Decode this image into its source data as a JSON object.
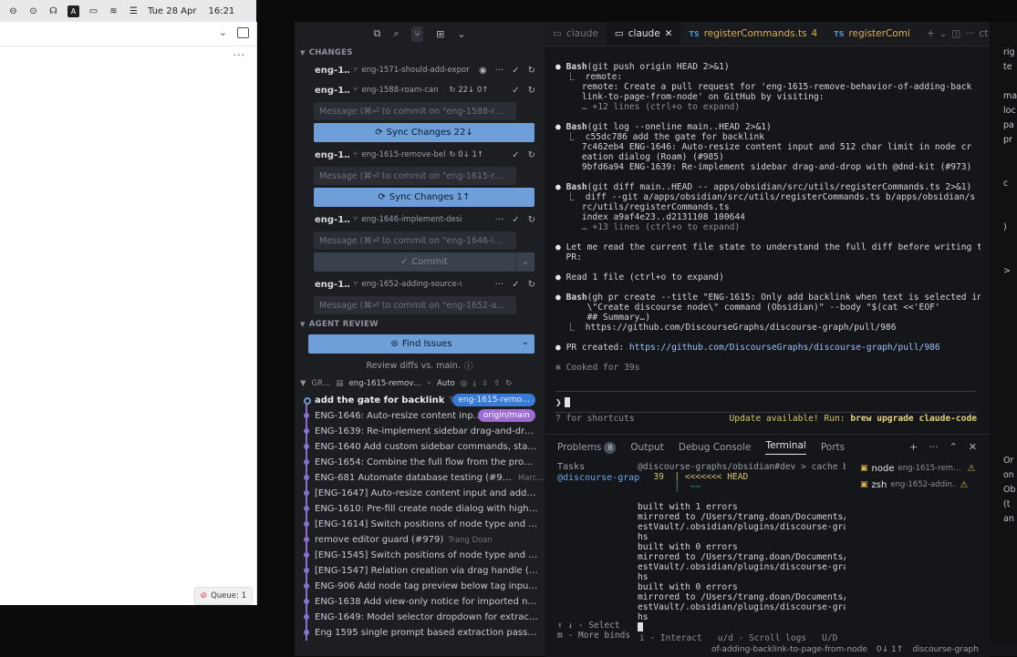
{
  "menubar": {
    "date": "Tue 28 Apr",
    "time": "16:21"
  },
  "left_window": {
    "queue": "Queue: 1"
  },
  "scm": {
    "section_changes": "CHANGES",
    "repos": [
      {
        "name": "eng-1…",
        "branch": "eng-1571-should-add-expor",
        "sync": ""
      },
      {
        "name": "eng-1…",
        "branch": "eng-1588-roam-can",
        "sync": "22↓ 0↑"
      },
      {
        "name": "eng-1…",
        "branch": "eng-1615-remove-bel",
        "sync": "0↓ 1↑"
      },
      {
        "name": "eng-1…",
        "branch": "eng-1646-implement-desig",
        "sync": ""
      },
      {
        "name": "eng-1…",
        "branch": "eng-1652-adding-source-ve",
        "sync": ""
      }
    ],
    "msg1": "Message (⌘⏎ to commit on \"eng-1588-r…",
    "sync1": "Sync Changes 22↓",
    "msg2": "Message (⌘⏎ to commit on \"eng-1615-r…",
    "sync2": "Sync Changes 1↑",
    "msg3": "Message (⌘⏎ to commit on \"eng-1646-i…",
    "commit": "Commit",
    "msg4": "Message (⌘⏎ to commit on \"eng-1652-a…",
    "section_review": "AGENT REVIEW",
    "find_issues": "Find Issues",
    "review_diffs": "Review diffs vs. main.",
    "graph_label": "GR…",
    "graph_branch": "eng-1615-remov…",
    "graph_auto": "Auto",
    "graph": [
      {
        "text": "add the gate for backlink",
        "author": "Tr…",
        "tag": "eng-1615-remo…",
        "tag_type": "blue"
      },
      {
        "text": "ENG-1646: Auto-resize content inp…",
        "author": "",
        "tag": "origin/main",
        "tag_type": "purple"
      },
      {
        "text": "ENG-1639: Re-implement sidebar drag-and-drop…",
        "author": "",
        "tag": "",
        "tag_type": ""
      },
      {
        "text": "ENG-1640 Add custom sidebar commands, starti…",
        "author": "",
        "tag": "",
        "tag_type": ""
      },
      {
        "text": "ENG-1654: Combine the full flow from the promp…",
        "author": "",
        "tag": "",
        "tag_type": ""
      },
      {
        "text": "ENG-681 Automate database testing (#957)",
        "author": "Marc…",
        "tag": "",
        "tag_type": ""
      },
      {
        "text": "[ENG-1647] Auto-resize content input and add fil…",
        "author": "",
        "tag": "",
        "tag_type": ""
      },
      {
        "text": "ENG-1610: Pre-fill create node dialog with highlig…",
        "author": "",
        "tag": "",
        "tag_type": ""
      },
      {
        "text": "[ENG-1614] Switch positions of node type and no…",
        "author": "",
        "tag": "",
        "tag_type": ""
      },
      {
        "text": "remove editor guard (#979)",
        "author": "Trang Doan",
        "tag": "",
        "tag_type": ""
      },
      {
        "text": "[ENG-1545] Switch positions of node type and no…",
        "author": "",
        "tag": "",
        "tag_type": ""
      },
      {
        "text": "[ENG-1547] Relation creation via drag handle (Ob…",
        "author": "",
        "tag": "",
        "tag_type": ""
      },
      {
        "text": "ENG-906 Add node tag preview below tag input i…",
        "author": "",
        "tag": "",
        "tag_type": ""
      },
      {
        "text": "ENG-1638 Add view-only notice for imported nod…",
        "author": "",
        "tag": "",
        "tag_type": ""
      },
      {
        "text": "ENG-1649: Model selector dropdown for extracti…",
        "author": "",
        "tag": "",
        "tag_type": ""
      },
      {
        "text": "Eng 1595 single prompt based extraction pass or…",
        "author": "",
        "tag": "",
        "tag_type": ""
      }
    ]
  },
  "editor": {
    "tabs": [
      {
        "label": "claude",
        "prefix": "",
        "badge": "",
        "active": false
      },
      {
        "label": "claude",
        "prefix": "",
        "badge": "",
        "active": true
      },
      {
        "label": "registerCommands.ts",
        "prefix": "TS",
        "badge": "4",
        "active": false
      },
      {
        "label": "registerComi",
        "prefix": "TS",
        "badge": "",
        "active": false
      }
    ],
    "tab_extra": "ct adv",
    "terminal_lines": [
      {
        "kind": "bullet",
        "text": "Bash(git push origin HEAD 2>&1)"
      },
      {
        "kind": "sub",
        "text": "  ⎿  remote:"
      },
      {
        "kind": "sub",
        "text": "     remote: Create a pull request for 'eng-1615-remove-behavior-of-adding-back"
      },
      {
        "kind": "sub",
        "text": "     link-to-page-from-node' on GitHub by visiting:"
      },
      {
        "kind": "dim",
        "text": "     … +12 lines (ctrl+o to expand)"
      },
      {
        "kind": "blank",
        "text": ""
      },
      {
        "kind": "bullet",
        "text": "Bash(git log --oneline main..HEAD 2>&1)"
      },
      {
        "kind": "sub",
        "text": "  ⎿  c55dc786 add the gate for backlink"
      },
      {
        "kind": "sub",
        "text": "     7c462eb4 ENG-1646: Auto-resize content input and 512 char limit in node cr"
      },
      {
        "kind": "sub",
        "text": "     eation dialog (Roam) (#985)"
      },
      {
        "kind": "sub",
        "text": "     9bfd6a94 ENG-1639: Re-implement sidebar drag-and-drop with @dnd-kit (#973)"
      },
      {
        "kind": "blank",
        "text": ""
      },
      {
        "kind": "bullet",
        "text": "Bash(git diff main..HEAD -- apps/obsidian/src/utils/registerCommands.ts 2>&1)"
      },
      {
        "kind": "sub",
        "text": "  ⎿  diff --git a/apps/obsidian/src/utils/registerCommands.ts b/apps/obsidian/s"
      },
      {
        "kind": "sub",
        "text": "     rc/utils/registerCommands.ts"
      },
      {
        "kind": "sub",
        "text": "     index a9af4e23..d2131108 100644"
      },
      {
        "kind": "dim",
        "text": "     … +13 lines (ctrl+o to expand)"
      },
      {
        "kind": "blank",
        "text": ""
      },
      {
        "kind": "plain",
        "text": "Let me read the current file state to understand the full diff before writing the"
      },
      {
        "kind": "cont",
        "text": "PR:"
      },
      {
        "kind": "blank",
        "text": ""
      },
      {
        "kind": "plain",
        "text": "Read 1 file (ctrl+o to expand)"
      },
      {
        "kind": "blank",
        "text": ""
      },
      {
        "kind": "bullet",
        "text": "Bash(gh pr create --title \"ENG-1615: Only add backlink when text is selected in"
      },
      {
        "kind": "sub",
        "text": "      \\\"Create discourse node\\\" command (Obsidian)\" --body \"$(cat <<'EOF'"
      },
      {
        "kind": "sub",
        "text": "      ## Summary…)"
      },
      {
        "kind": "sub",
        "text": "  ⎿  https://github.com/DiscourseGraphs/discourse-graph/pull/986"
      },
      {
        "kind": "blank",
        "text": ""
      },
      {
        "kind": "link",
        "text": "PR created: https://github.com/DiscourseGraphs/discourse-graph/pull/986"
      },
      {
        "kind": "blank",
        "text": ""
      },
      {
        "kind": "star",
        "text": "Cooked for 39s"
      }
    ],
    "prompt_char": "❯",
    "hint_left": "? for shortcuts",
    "hint_right": "Update available! Run: brew upgrade claude-code"
  },
  "panel": {
    "tabs": [
      "Problems",
      "Output",
      "Debug Console",
      "Terminal",
      "Ports"
    ],
    "problems_count": "8",
    "active_tab": "Terminal",
    "tasks_title": "Tasks",
    "tasks_item": "@discourse-grap",
    "term_header": "@discourse-graphs/obsidian#dev > cache b",
    "term_lines": [
      "   39  │ <<<<<<< HEAD",
      "       │  ~~",
      "",
      "built with 1 errors",
      "mirrored to /Users/trang.doan/Documents/t",
      "estVault/.obsidian/plugins/discourse-grap",
      "hs",
      "built with 0 errors",
      "mirrored to /Users/trang.doan/Documents/t",
      "estVault/.obsidian/plugins/discourse-grap",
      "hs",
      "built with 0 errors",
      "mirrored to /Users/trang.doan/Documents/t",
      "estVault/.obsidian/plugins/discourse-grap",
      "hs"
    ],
    "list_hint1": "↑ ↓ - Select",
    "list_hint2": "m - More binds",
    "term_bar": "i - Interact   u/d - Scroll logs   U/D",
    "procs": [
      {
        "name": "node",
        "branch": "eng-1615-rem…"
      },
      {
        "name": "zsh",
        "branch": "eng-1652-addin…"
      }
    ]
  },
  "right_pane": {
    "lines": [
      "rig",
      "te",
      "",
      "ma",
      "loc",
      "pa",
      "pr",
      "",
      "",
      "c",
      "",
      "",
      ")",
      "",
      "",
      ">",
      "",
      "",
      "",
      "",
      "",
      "",
      "",
      "",
      "",
      "",
      "",
      "",
      "Or",
      "on",
      "Ob",
      "(t",
      "an"
    ]
  },
  "statusbar": {
    "text1": "of-adding-backlink-to-page-from-node",
    "text2": "0↓ 1↑",
    "text3": "discourse-graph"
  }
}
